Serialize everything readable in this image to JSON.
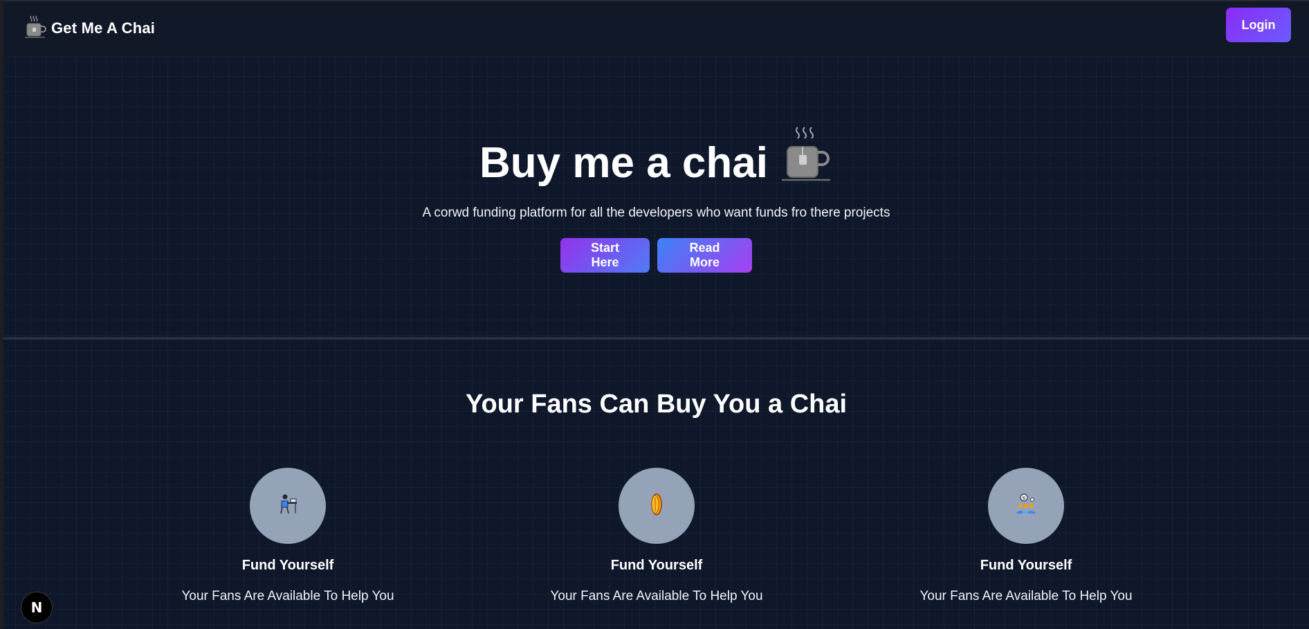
{
  "navbar": {
    "brand": "Get Me A Chai",
    "login_label": "Login"
  },
  "hero": {
    "title": "Buy me a chai",
    "subtitle": "A corwd funding platform for all the developers who want funds fro there projects",
    "start_label": "Start Here",
    "read_more_label": "Read More"
  },
  "fans_section": {
    "heading": "Your Fans Can Buy You a Chai",
    "features": [
      {
        "icon": "developer-at-desk-icon",
        "title": "Fund Yourself",
        "description": "Your Fans Are Available To Help You"
      },
      {
        "icon": "coin-icon",
        "title": "Fund Yourself",
        "description": "Your Fans Are Available To Help You"
      },
      {
        "icon": "group-icon",
        "title": "Fund Yourself",
        "description": "Your Fans Are Available To Help You"
      }
    ]
  },
  "next_badge": "N",
  "colors": {
    "background": "#0f172a",
    "navbar": "#111827",
    "accent_purple": "#8b2cf5",
    "accent_blue": "#4f7cf7",
    "feature_circle": "#94a3b8"
  }
}
